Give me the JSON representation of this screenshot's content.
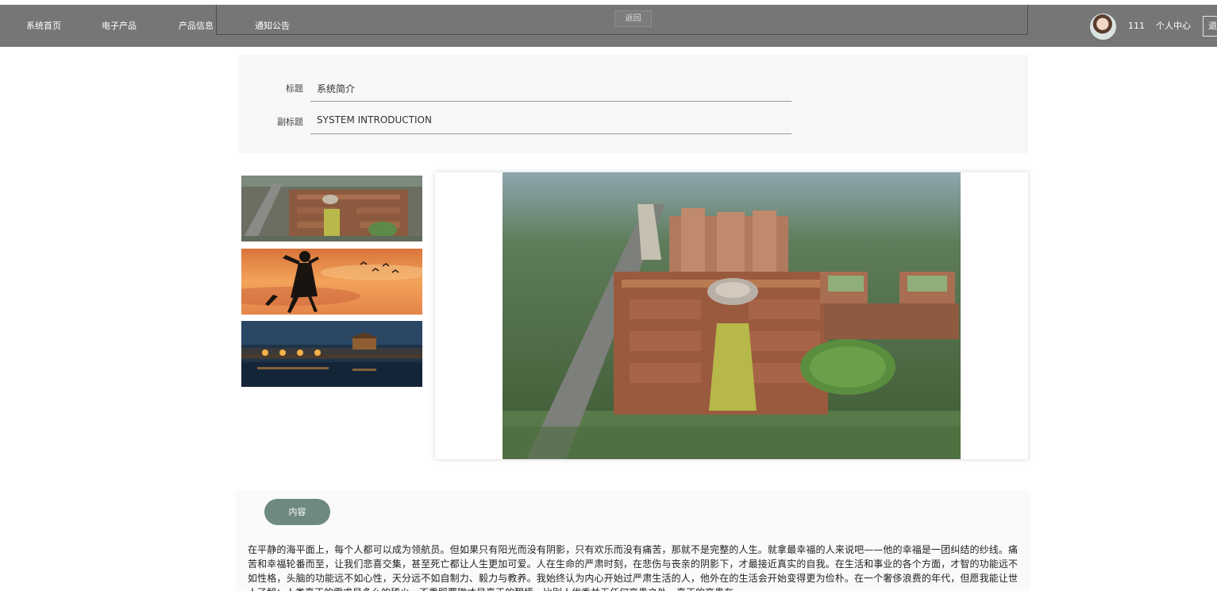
{
  "nav": {
    "items": [
      "系统首页",
      "电子产品",
      "产品信息",
      "通知公告"
    ],
    "back_label": "返回"
  },
  "user": {
    "name": "111",
    "center_label": "个人中心",
    "logout_label": "退出"
  },
  "form": {
    "title_label": "标题",
    "title_value": "系统简介",
    "subtitle_label": "副标题",
    "subtitle_value": "SYSTEM INTRODUCTION"
  },
  "content": {
    "tab_label": "内容",
    "text": "在平静的海平面上，每个人都可以成为领航员。但如果只有阳光而没有阴影，只有欢乐而没有痛苦，那就不是完整的人生。就拿最幸福的人来说吧——他的幸福是一团纠结的纱线。痛苦和幸福轮番而至，让我们悲喜交集，甚至死亡都让人生更加可爱。人在生命的严肃时刻，在悲伤与丧亲的阴影下，才最接近真实的自我。在生活和事业的各个方面，才智的功能远不如性格，头脑的功能远不如心性，天分远不如自制力、毅力与教养。我始终认为内心开始过严肃生活的人，他外在的生活会开始变得更为俭朴。在一个奢侈浪费的年代，但愿我能让世人了解：人类真正的需求是多么的稀少。不重蹈覆辙才是真正的醒悟。比别人优秀并无任何高贵之处，真正的高贵在"
  },
  "icons": {
    "avatar": "user-avatar",
    "thumb1": "campus-aerial-image",
    "thumb2": "silhouette-sunset-image",
    "thumb3": "night-bridge-image",
    "main": "campus-aerial-image"
  },
  "colors": {
    "topbar": "#767676",
    "tab": "#6e8a80"
  }
}
